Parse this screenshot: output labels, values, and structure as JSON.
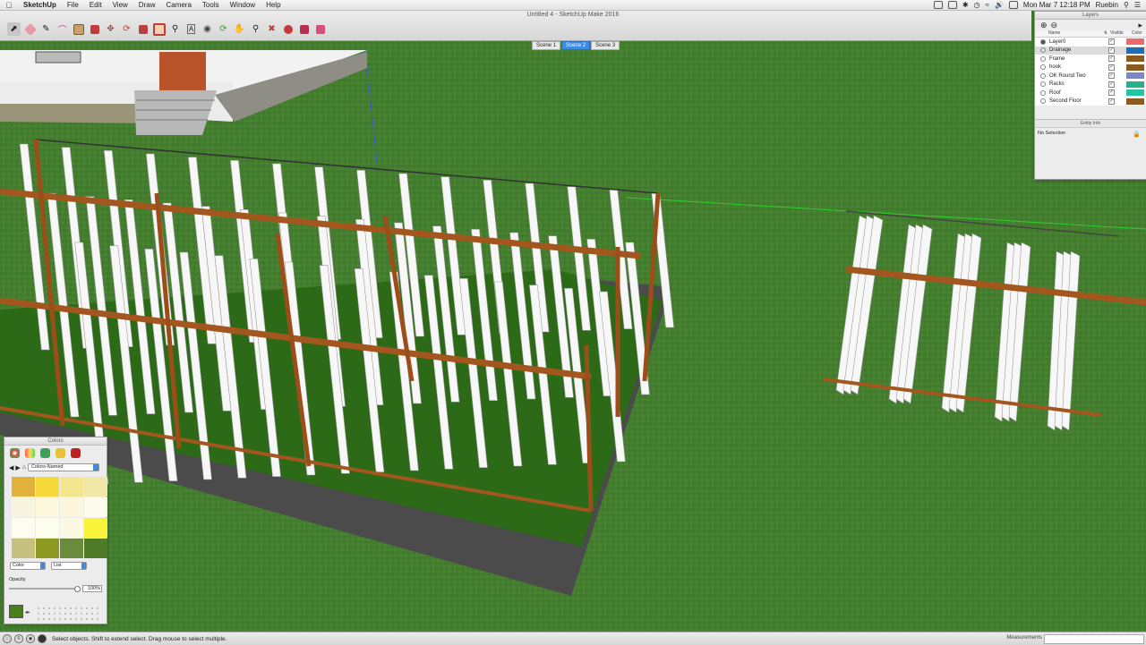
{
  "menubar": {
    "app": "SketchUp",
    "items": [
      "File",
      "Edit",
      "View",
      "Draw",
      "Camera",
      "Tools",
      "Window",
      "Help"
    ],
    "clock": "Mon Mar 7  12:18 PM",
    "user": "Ruebin"
  },
  "window": {
    "title": "Untitled 4 - SketchUp Make 2016"
  },
  "toolbar": {
    "tools": [
      "select-icon",
      "eraser-icon",
      "pencil-icon",
      "arc-icon",
      "rectangle-icon",
      "push-pull-icon",
      "move-icon",
      "rotate-icon",
      "scale-icon",
      "offset-icon",
      "tape-measure-icon",
      "text-icon",
      "paint-bucket-icon",
      "orbit-icon",
      "pan-icon",
      "zoom-icon",
      "zoom-extents-icon",
      "3d-warehouse-icon",
      "extension-warehouse-icon",
      "layout-icon"
    ]
  },
  "scenes": {
    "tabs": [
      "Scene 1",
      "Scene 2",
      "Scene 3"
    ],
    "active": "Scene 2"
  },
  "layers": {
    "title": "Layers",
    "columns": {
      "name": "Name",
      "visible": "Visible",
      "color": "Color"
    },
    "rows": [
      {
        "name": "Layer0",
        "color": "#e86a6a",
        "active": true
      },
      {
        "name": "Drainage",
        "color": "#1e6db5",
        "active": false,
        "selected": true
      },
      {
        "name": "Frame",
        "color": "#8a5a1e",
        "active": false
      },
      {
        "name": "hook",
        "color": "#8a5a1e",
        "active": false
      },
      {
        "name": "OK Round Two",
        "color": "#7a86c8",
        "active": false
      },
      {
        "name": "Racks",
        "color": "#27b08a",
        "active": false
      },
      {
        "name": "Roof",
        "color": "#22c4a4",
        "active": false
      },
      {
        "name": "Second Floor",
        "color": "#8a5a1e",
        "active": false
      }
    ]
  },
  "entity_info": {
    "title": "Entity Info",
    "selection": "No Selection"
  },
  "colors_panel": {
    "title": "Colors",
    "library": "Colors-Named",
    "swatches": [
      "#e2b13c",
      "#f7d83a",
      "#f3e68e",
      "#f1e7a8",
      "#f7f4df",
      "#fef8dc",
      "#fbf6dd",
      "#fdfbec",
      "#fefcf0",
      "#fdfdec",
      "#fbf9e4",
      "#f9f43a",
      "#c8c07e",
      "#8c9a22",
      "#6a8a3e",
      "#4f7a26"
    ],
    "mode": "Color",
    "view": "List",
    "opacity_label": "Opacity",
    "opacity_value": "100%",
    "current_color": "#4a7e1a"
  },
  "statusbar": {
    "hint": "Select objects. Shift to extend select. Drag mouse to select multiple.",
    "measurements_label": "Measurements"
  }
}
